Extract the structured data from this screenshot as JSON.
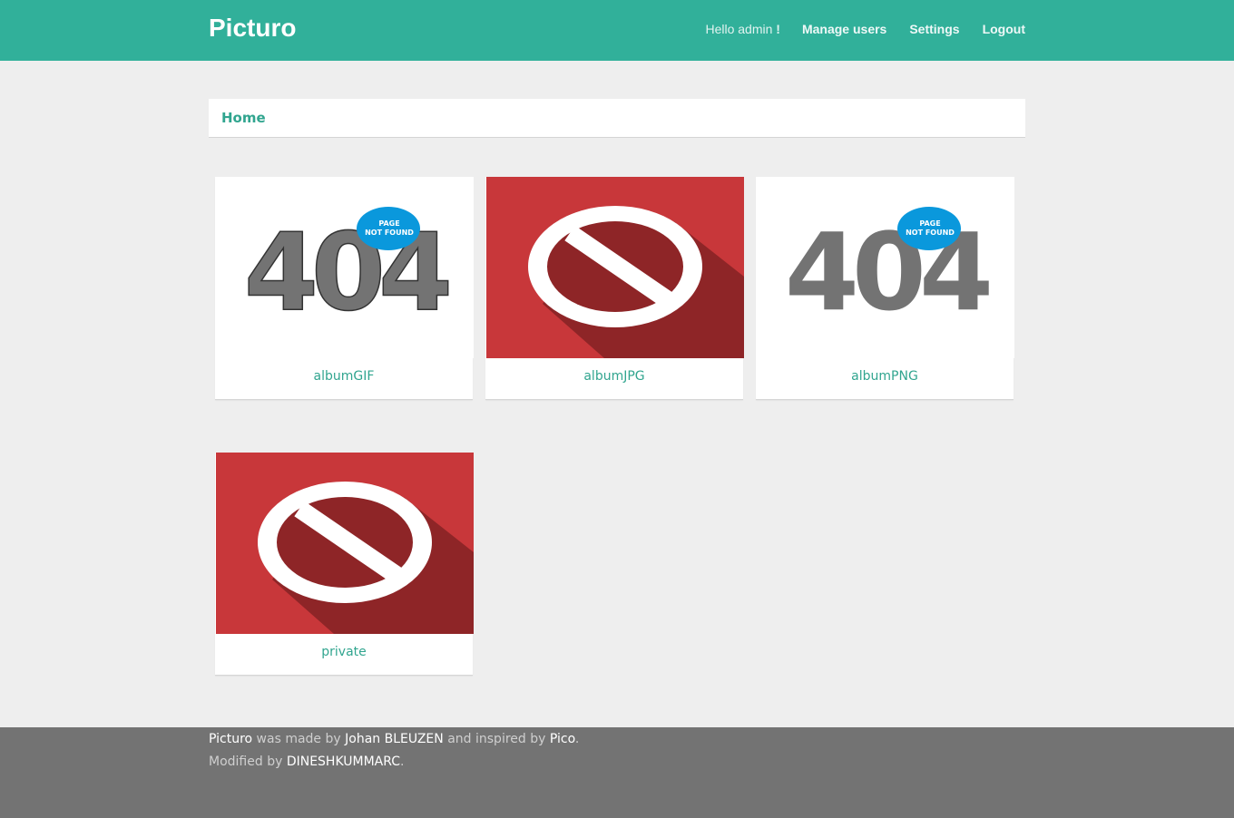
{
  "header": {
    "brand": "Picturo",
    "greeting_prefix": "Hello admin",
    "greeting_suffix": " !",
    "nav": {
      "manage_users": "Manage users",
      "settings": "Settings",
      "logout": "Logout"
    }
  },
  "breadcrumb": {
    "home": "Home"
  },
  "albums": [
    {
      "label": "albumGIF",
      "thumb": "page-not-found-404",
      "badge_line1": "PAGE",
      "badge_line2": "NOT FOUND",
      "badge_number": "404"
    },
    {
      "label": "albumJPG",
      "thumb": "prohibited-sign"
    },
    {
      "label": "albumPNG",
      "thumb": "page-not-found-404",
      "badge_line1": "PAGE",
      "badge_line2": "NOT FOUND",
      "badge_number": "404"
    },
    {
      "label": "private",
      "thumb": "prohibited-sign"
    }
  ],
  "footer": {
    "line1": {
      "brand": "Picturo",
      "made_by": " was made by ",
      "author": "Johan BLEUZEN",
      "inspired": " and inspired by ",
      "inspiration": "Pico",
      "end": "."
    },
    "line2": {
      "modified": "Modified by ",
      "modifier": "DINESHKUMMARC",
      "end": "."
    }
  },
  "colors": {
    "accent": "#31b09a",
    "link": "#31a58f",
    "background": "#eeeeee",
    "footer": "#737373",
    "prohibit_red": "#c8373a",
    "prohibit_dark": "#8e2527",
    "badge_blue": "#0a98dc",
    "digits_gray": "#737373"
  }
}
